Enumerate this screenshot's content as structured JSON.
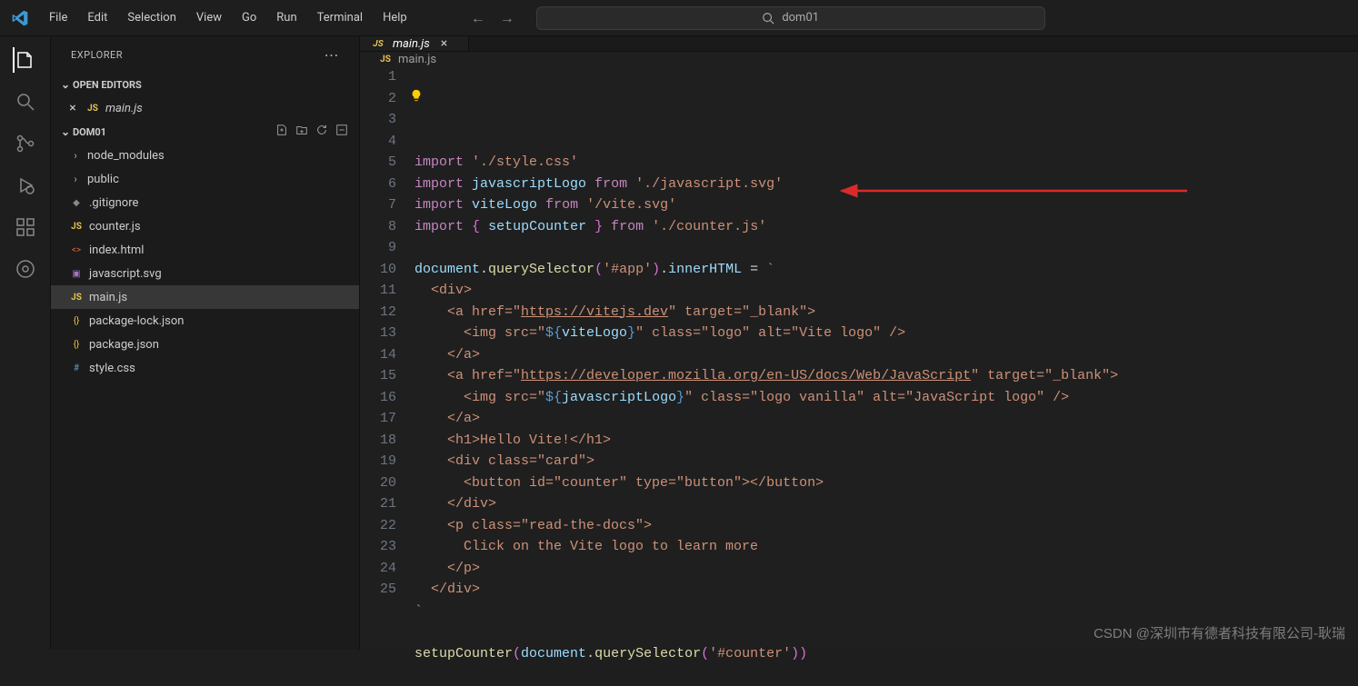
{
  "menu": [
    "File",
    "Edit",
    "Selection",
    "View",
    "Go",
    "Run",
    "Terminal",
    "Help"
  ],
  "search": {
    "text": "dom01"
  },
  "sidebar": {
    "title": "EXPLORER",
    "openEditors": {
      "label": "OPEN EDITORS",
      "items": [
        {
          "icon": "js",
          "iconText": "JS",
          "name": "main.js",
          "italic": true,
          "close": "×"
        }
      ]
    },
    "folder": {
      "name": "DOM01",
      "actions": [
        "new-file-icon",
        "new-folder-icon",
        "refresh-icon",
        "collapse-icon"
      ]
    },
    "tree": [
      {
        "type": "folder",
        "name": "node_modules",
        "depth": 0
      },
      {
        "type": "folder",
        "name": "public",
        "depth": 0
      },
      {
        "type": "file",
        "name": ".gitignore",
        "icon": "gitignore",
        "iconText": "◆",
        "depth": 0
      },
      {
        "type": "file",
        "name": "counter.js",
        "icon": "js",
        "iconText": "JS",
        "depth": 0
      },
      {
        "type": "file",
        "name": "index.html",
        "icon": "html",
        "iconText": "<>",
        "depth": 0
      },
      {
        "type": "file",
        "name": "javascript.svg",
        "icon": "svg",
        "iconText": "▣",
        "depth": 0
      },
      {
        "type": "file",
        "name": "main.js",
        "icon": "js",
        "iconText": "JS",
        "depth": 0,
        "selected": true
      },
      {
        "type": "file",
        "name": "package-lock.json",
        "icon": "json",
        "iconText": "{}",
        "depth": 0
      },
      {
        "type": "file",
        "name": "package.json",
        "icon": "json",
        "iconText": "{}",
        "depth": 0
      },
      {
        "type": "file",
        "name": "style.css",
        "icon": "css",
        "iconText": "#",
        "depth": 0
      }
    ]
  },
  "tab": {
    "icon": "JS",
    "name": "main.js",
    "close": "×"
  },
  "breadcrumb": {
    "icon": "JS",
    "name": "main.js"
  },
  "code": {
    "lines": [
      [
        {
          "t": "keyword",
          "v": "import"
        },
        {
          "t": "default",
          "v": " "
        },
        {
          "t": "string",
          "v": "'./style.css'"
        }
      ],
      [
        {
          "t": "keyword",
          "v": "import"
        },
        {
          "t": "default",
          "v": " "
        },
        {
          "t": "var",
          "v": "javascriptLogo"
        },
        {
          "t": "default",
          "v": " "
        },
        {
          "t": "keyword",
          "v": "from"
        },
        {
          "t": "default",
          "v": " "
        },
        {
          "t": "string",
          "v": "'./javascript.svg'"
        }
      ],
      [
        {
          "t": "keyword",
          "v": "import"
        },
        {
          "t": "default",
          "v": " "
        },
        {
          "t": "var",
          "v": "viteLogo"
        },
        {
          "t": "default",
          "v": " "
        },
        {
          "t": "keyword",
          "v": "from"
        },
        {
          "t": "default",
          "v": " "
        },
        {
          "t": "string",
          "v": "'/vite.svg'"
        }
      ],
      [
        {
          "t": "keyword",
          "v": "import"
        },
        {
          "t": "default",
          "v": " "
        },
        {
          "t": "braces",
          "v": "{"
        },
        {
          "t": "default",
          "v": " "
        },
        {
          "t": "var",
          "v": "setupCounter"
        },
        {
          "t": "default",
          "v": " "
        },
        {
          "t": "braces",
          "v": "}"
        },
        {
          "t": "default",
          "v": " "
        },
        {
          "t": "keyword",
          "v": "from"
        },
        {
          "t": "default",
          "v": " "
        },
        {
          "t": "string",
          "v": "'./counter.js'"
        }
      ],
      [],
      [
        {
          "t": "var",
          "v": "document"
        },
        {
          "t": "default",
          "v": "."
        },
        {
          "t": "func",
          "v": "querySelector"
        },
        {
          "t": "braces",
          "v": "("
        },
        {
          "t": "string",
          "v": "'#app'"
        },
        {
          "t": "braces",
          "v": ")"
        },
        {
          "t": "default",
          "v": "."
        },
        {
          "t": "prop",
          "v": "innerHTML"
        },
        {
          "t": "default",
          "v": " = "
        },
        {
          "t": "string",
          "v": "`"
        }
      ],
      [
        {
          "t": "string",
          "v": "  <div>"
        }
      ],
      [
        {
          "t": "string",
          "v": "    <a href=\""
        },
        {
          "t": "string underline",
          "v": "https://vitejs.dev"
        },
        {
          "t": "string",
          "v": "\" target=\"_blank\">"
        }
      ],
      [
        {
          "t": "string",
          "v": "      <img src=\""
        },
        {
          "t": "interp",
          "v": "${"
        },
        {
          "t": "interpvar",
          "v": "viteLogo"
        },
        {
          "t": "interp",
          "v": "}"
        },
        {
          "t": "string",
          "v": "\" class=\"logo\" alt=\"Vite logo\" />"
        }
      ],
      [
        {
          "t": "string",
          "v": "    </a>"
        }
      ],
      [
        {
          "t": "string",
          "v": "    <a href=\""
        },
        {
          "t": "string underline",
          "v": "https://developer.mozilla.org/en-US/docs/Web/JavaScript"
        },
        {
          "t": "string",
          "v": "\" target=\"_blank\">"
        }
      ],
      [
        {
          "t": "string",
          "v": "      <img src=\""
        },
        {
          "t": "interp",
          "v": "${"
        },
        {
          "t": "interpvar",
          "v": "javascriptLogo"
        },
        {
          "t": "interp",
          "v": "}"
        },
        {
          "t": "string",
          "v": "\" class=\"logo vanilla\" alt=\"JavaScript logo\" />"
        }
      ],
      [
        {
          "t": "string",
          "v": "    </a>"
        }
      ],
      [
        {
          "t": "string",
          "v": "    <h1>Hello Vite!</h1>"
        }
      ],
      [
        {
          "t": "string",
          "v": "    <div class=\"card\">"
        }
      ],
      [
        {
          "t": "string",
          "v": "      <button id=\"counter\" type=\"button\"></button>"
        }
      ],
      [
        {
          "t": "string",
          "v": "    </div>"
        }
      ],
      [
        {
          "t": "string",
          "v": "    <p class=\"read-the-docs\">"
        }
      ],
      [
        {
          "t": "string",
          "v": "      Click on the Vite logo to learn more"
        }
      ],
      [
        {
          "t": "string",
          "v": "    </p>"
        }
      ],
      [
        {
          "t": "string",
          "v": "  </div>"
        }
      ],
      [
        {
          "t": "string",
          "v": "`"
        }
      ],
      [],
      [
        {
          "t": "func",
          "v": "setupCounter"
        },
        {
          "t": "braces",
          "v": "("
        },
        {
          "t": "var",
          "v": "document"
        },
        {
          "t": "default",
          "v": "."
        },
        {
          "t": "func",
          "v": "querySelector"
        },
        {
          "t": "braces",
          "v": "("
        },
        {
          "t": "string",
          "v": "'#counter'"
        },
        {
          "t": "braces",
          "v": ")"
        },
        {
          "t": "braces",
          "v": ")"
        }
      ],
      []
    ]
  },
  "watermark": "CSDN @深圳市有德者科技有限公司-耿瑞"
}
